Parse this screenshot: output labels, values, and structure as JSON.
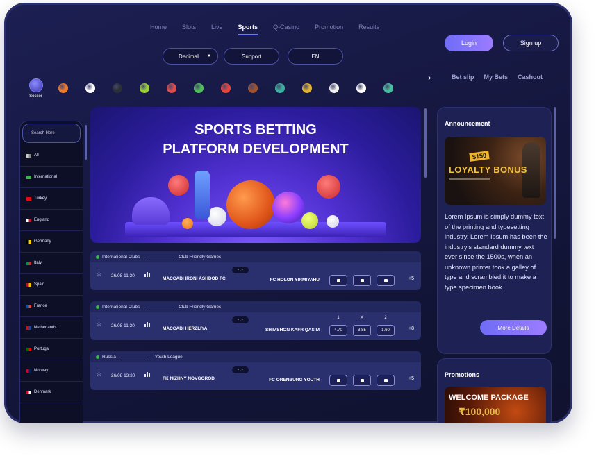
{
  "nav": {
    "items": [
      "Home",
      "Slots",
      "Live",
      "Sports",
      "Q-Casino",
      "Promotion",
      "Results"
    ],
    "active": "Sports"
  },
  "auth": {
    "login": "Login",
    "signup": "Sign up"
  },
  "controls": {
    "odds_format": "Decimal",
    "support": "Support",
    "language": "EN"
  },
  "sports": {
    "first_label": "Soccer",
    "icons": [
      "soccer-icon",
      "basketball-icon",
      "baseball-icon",
      "ice-hockey-icon",
      "tennis-icon",
      "handball-icon",
      "golf-icon",
      "boxing-icon",
      "american-football-icon",
      "esports-icon",
      "cricket-icon",
      "volleyball-icon",
      "football-icon",
      "table-tennis-icon"
    ],
    "colors": [
      "#4c44c8",
      "#f07a2b",
      "#ffffff",
      "#2c2f36",
      "#9bd23a",
      "#e04d4d",
      "#4fbf5a",
      "#e8453c",
      "#a0522d",
      "#3ab0a0",
      "#e0b030",
      "#f2f2f2",
      "#ffffff",
      "#46c0a0"
    ]
  },
  "slip_tabs": [
    "Bet slip",
    "My Bets",
    "Cashout"
  ],
  "sidebar": {
    "search_placeholder": "Search Here",
    "items": [
      {
        "label": "All",
        "flag": [
          "#cccccc",
          "#888888"
        ]
      },
      {
        "label": "International",
        "flag": [
          "#3fb34f",
          "#3fb34f"
        ]
      },
      {
        "label": "Turkey",
        "flag": [
          "#e30a17",
          "#e30a17"
        ]
      },
      {
        "label": "England",
        "flag": [
          "#ffffff",
          "#cf142b"
        ]
      },
      {
        "label": "Germany",
        "flag": [
          "#000000",
          "#ffce00"
        ]
      },
      {
        "label": "Italy",
        "flag": [
          "#009246",
          "#ce2b37"
        ]
      },
      {
        "label": "Spain",
        "flag": [
          "#aa151b",
          "#f1bf00"
        ]
      },
      {
        "label": "France",
        "flag": [
          "#0055a4",
          "#ef4135"
        ]
      },
      {
        "label": "Netherlands",
        "flag": [
          "#ae1c28",
          "#21468b"
        ]
      },
      {
        "label": "Portugal",
        "flag": [
          "#006600",
          "#ff0000"
        ]
      },
      {
        "label": "Norway",
        "flag": [
          "#ba0c2f",
          "#00205b"
        ]
      },
      {
        "label": "Denmark",
        "flag": [
          "#c8102e",
          "#ffffff"
        ]
      }
    ]
  },
  "hero": {
    "line1": "SPORTS BETTING",
    "line2": "PLATFORM DEVELOPMENT"
  },
  "events": [
    {
      "league": "International Clubs",
      "competition": "Club Friendly Games",
      "date": "26/08 11:30",
      "score": "- : -",
      "home": "MACCABI IRONI ASHDOD FC",
      "away": "FC HOLON YIRMIYAHU",
      "odds": [
        "",
        "",
        ""
      ],
      "headers": [
        "",
        "",
        ""
      ],
      "more": "+5"
    },
    {
      "league": "International Clubs",
      "competition": "Club Friendly Games",
      "date": "26/08 11:30",
      "score": "- : -",
      "home": "MACCABI HERZLIYA",
      "away": "SHIMSHON KAFR QASIM",
      "odds": [
        "4.70",
        "3.85",
        "1.60"
      ],
      "headers": [
        "1",
        "X",
        "2"
      ],
      "more": "+8"
    },
    {
      "league": "Russia",
      "competition": "Youth League",
      "date": "26/08 13:30",
      "score": "- : -",
      "home": "FK NIZHNY NOVGOROD",
      "away": "FC ORENBURG YOUTH",
      "odds": [
        "",
        "",
        ""
      ],
      "headers": [
        "",
        "",
        ""
      ],
      "more": "+5"
    }
  ],
  "announcement": {
    "title": "Announcement",
    "banner_amount": "$150",
    "banner_text": "LOYALTY BONUS",
    "body": "Lorem Ipsum is simply dummy text of the printing and typesetting industry. Lorem Ipsum has been the industry's standard dummy text ever since the 1500s, when an unknown printer took a galley of type and scrambled it to make a type specimen book.",
    "button": "More Details"
  },
  "promotions": {
    "title": "Promotions",
    "banner_text": "WELCOME PACKAGE",
    "banner_amount": "₹100,000"
  }
}
